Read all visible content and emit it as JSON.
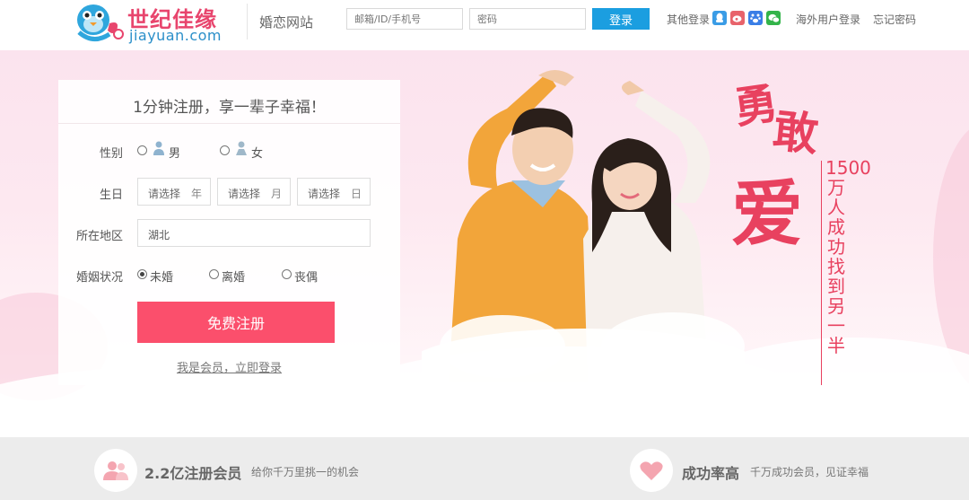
{
  "header": {
    "logo_cn": "世纪佳缘",
    "logo_en": "jiayuan.com",
    "site_name": "婚恋网站",
    "username_placeholder": "邮箱/ID/手机号",
    "password_placeholder": "密码",
    "login_label": "登录",
    "other_login_label": "其他登录",
    "overseas_login": "海外用户登录",
    "forgot_password": "忘记密码",
    "social_icons": [
      "qq-icon",
      "weibo-icon",
      "baidu-icon",
      "wechat-icon"
    ]
  },
  "register": {
    "title": "1分钟注册，享一辈子幸福！",
    "gender_label": "性别",
    "gender_male": "男",
    "gender_female": "女",
    "birthday_label": "生日",
    "year": {
      "placeholder": "请选择",
      "unit": "年"
    },
    "month": {
      "placeholder": "请选择",
      "unit": "月"
    },
    "day": {
      "placeholder": "请选择",
      "unit": "日"
    },
    "region_label": "所在地区",
    "region_value": "湖北",
    "marital_label": "婚姻状况",
    "marital_options": [
      "未婚",
      "离婚",
      "丧偶"
    ],
    "marital_selected": "未婚",
    "submit_label": "免费注册",
    "member_link": "我是会员，立即登录"
  },
  "slogan": {
    "char1": "勇",
    "char2": "敢",
    "char3": "爱",
    "vertical": "1500万人成功找到另一半"
  },
  "features": [
    {
      "icon": "members-icon",
      "title": "2.2亿注册会员",
      "desc": "给你千万里挑一的机会"
    },
    {
      "icon": "heart-icon",
      "title": "成功率高",
      "desc": "千万成功会员，见证幸福"
    }
  ],
  "colors": {
    "brand_pink": "#e8456d",
    "login_blue": "#1b9ee0",
    "register_button": "#fb4f6c"
  }
}
